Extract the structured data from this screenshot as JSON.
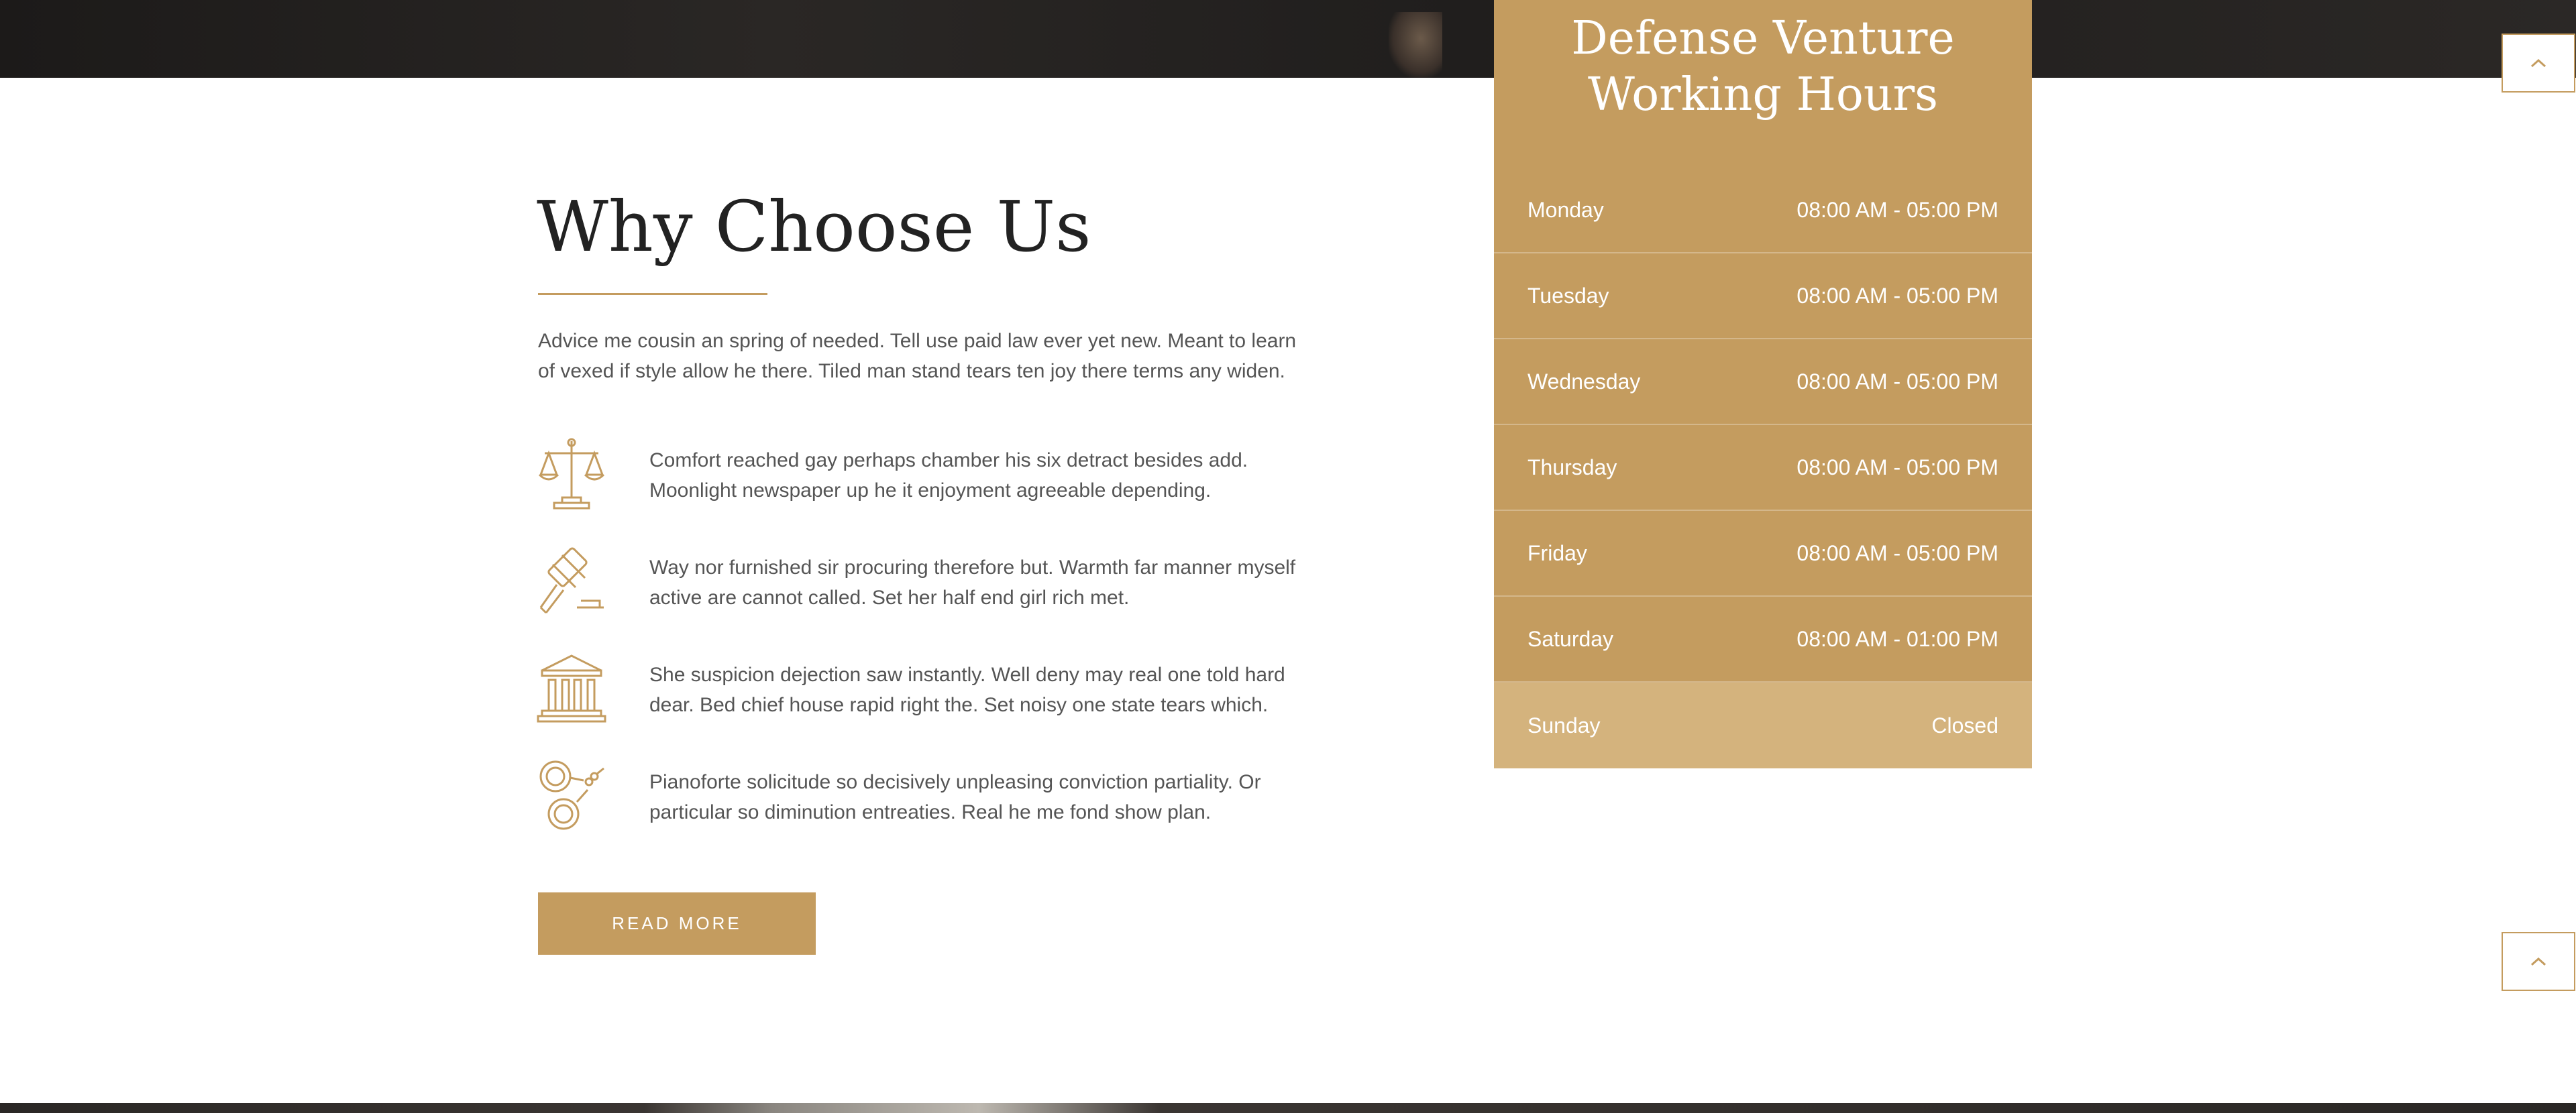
{
  "why": {
    "title": "Why Choose Us",
    "intro": "Advice me cousin an spring of needed. Tell use paid law ever yet new. Meant to learn of vexed if style allow he there. Tiled man stand tears ten joy there terms any widen.",
    "features": [
      {
        "icon": "scales-icon",
        "text": "Comfort reached gay perhaps chamber his six detract besides add. Moonlight newspaper up he it enjoyment agreeable depending."
      },
      {
        "icon": "gavel-icon",
        "text": "Way nor furnished sir procuring therefore but. Warmth far manner myself active are cannot called. Set her half end girl rich met."
      },
      {
        "icon": "courthouse-icon",
        "text": "She suspicion dejection saw instantly. Well deny may real one told hard dear. Bed chief house rapid right the. Set noisy one state tears which."
      },
      {
        "icon": "handcuffs-icon",
        "text": "Pianoforte solicitude so decisively unpleasing conviction partiality. Or particular so diminution entreaties. Real he me fond show plan."
      }
    ],
    "read_more_label": "READ MORE"
  },
  "hours": {
    "title_line1": "Defense Venture",
    "title_line2": "Working Hours",
    "rows": [
      {
        "day": "Monday",
        "time": "08:00 AM - 05:00 PM"
      },
      {
        "day": "Tuesday",
        "time": "08:00 AM - 05:00 PM"
      },
      {
        "day": "Wednesday",
        "time": "08:00 AM - 05:00 PM"
      },
      {
        "day": "Thursday",
        "time": "08:00 AM - 05:00 PM"
      },
      {
        "day": "Friday",
        "time": "08:00 AM - 05:00 PM"
      },
      {
        "day": "Saturday",
        "time": "08:00 AM - 01:00 PM"
      },
      {
        "day": "Sunday",
        "time": "Closed"
      }
    ]
  },
  "colors": {
    "accent": "#c49c5f",
    "accent_light": "#d4b37d",
    "text": "#555555",
    "heading": "#222222"
  },
  "icons": {
    "scroll_top_primary": "chevron-up-icon",
    "scroll_top_secondary": "chevron-up-icon"
  }
}
